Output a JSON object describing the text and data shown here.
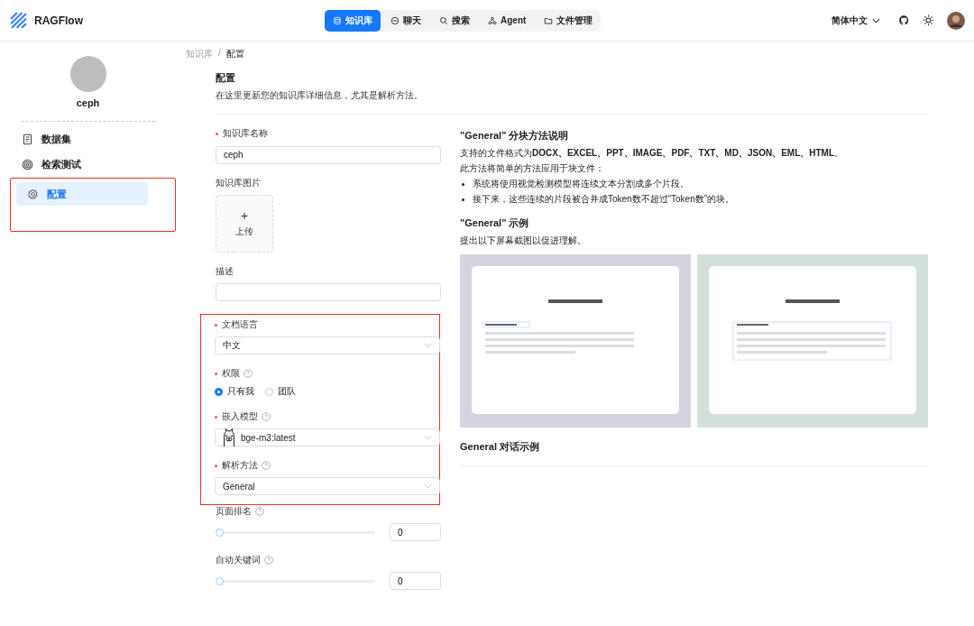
{
  "app": {
    "name": "RAGFlow"
  },
  "nav": [
    {
      "label": "知识库",
      "selected": true
    },
    {
      "label": "聊天",
      "selected": false
    },
    {
      "label": "搜索",
      "selected": false
    },
    {
      "label": "Agent",
      "selected": false
    },
    {
      "label": "文件管理",
      "selected": false
    }
  ],
  "header_right": {
    "language": "简体中文"
  },
  "sidebar": {
    "name": "ceph",
    "items": [
      {
        "label": "数据集",
        "selected": false,
        "highlighted": false
      },
      {
        "label": "检索测试",
        "selected": false,
        "highlighted": false
      },
      {
        "label": "配置",
        "selected": true,
        "highlighted": true
      }
    ]
  },
  "breadcrumb": {
    "items": [
      "知识库",
      "配置"
    ],
    "separator": "/"
  },
  "page": {
    "title": "配置",
    "subtitle": "在这里更新您的知识库详细信息，尤其是解析方法。"
  },
  "form": {
    "sections": [
      {
        "highlighted": false,
        "fields": [
          {
            "kind": "input",
            "label": "知识库名称",
            "required": true,
            "help": false,
            "value": "ceph"
          },
          {
            "kind": "upload",
            "label": "知识库图片",
            "required": false,
            "help": false,
            "icon_text": "+",
            "button": "上传"
          },
          {
            "kind": "input",
            "label": "描述",
            "required": false,
            "help": false
          }
        ]
      },
      {
        "highlighted": true,
        "fields": [
          {
            "kind": "select",
            "label": "文档语言",
            "required": true,
            "help": false,
            "value": "中文"
          },
          {
            "kind": "radio",
            "label": "权限",
            "required": true,
            "help": true,
            "options": [
              {
                "label": "只有我",
                "selected": true
              },
              {
                "label": "团队",
                "selected": false
              }
            ]
          },
          {
            "kind": "select",
            "label": "嵌入模型",
            "required": true,
            "help": true,
            "value": "bge-m3:latest",
            "model_icon": true
          },
          {
            "kind": "select",
            "label": "解析方法",
            "required": true,
            "help": true,
            "value": "General"
          }
        ]
      },
      {
        "highlighted": false,
        "fields": [
          {
            "kind": "slider",
            "label": "页面排名",
            "required": false,
            "help": true,
            "level": 0,
            "value": "0"
          },
          {
            "kind": "slider",
            "label": "自动关键词",
            "required": false,
            "help": true,
            "level": 0,
            "value": "0"
          }
        ]
      }
    ]
  },
  "guide": {
    "title": "\"General\" 分块方法说明",
    "formats": "支持的文件格式为**DOCX、EXCEL、PPT、IMAGE、PDF、TXT、MD、JSON、EML、HTML**。",
    "intro": "此方法将简单的方法应用于块文件：",
    "bullets": [
      "系统将使用视觉检测模型将连续文本分割成多个片段。",
      "接下来，这些连续的片段被合并成Token数不超过“Token数”的块。"
    ],
    "example_title": "\"General\" 示例",
    "example_desc": "提出以下屏幕截图以促进理解。",
    "examples": [
      {
        "kind": "picture"
      },
      {
        "kind": "picture"
      }
    ],
    "dialog_title": "General 对话示例"
  }
}
